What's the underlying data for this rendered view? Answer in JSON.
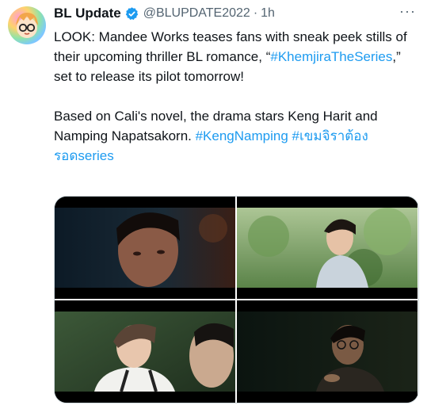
{
  "author": {
    "name": "BL Update",
    "handle": "@BLUPDATE2022",
    "separator": "·",
    "time": "1h",
    "verified": true,
    "avatar_icon": "chibi-glasses-avatar"
  },
  "more_label": "···",
  "tweet": {
    "p1_a": "LOOK: Mandee Works teases fans with sneak peek stills of their upcoming thriller BL romance, “",
    "hashtag1": "#KhemjiraTheSeries",
    "p1_b": ",” set to release its pilot tomorrow!",
    "p2_a": "Based on Cali's novel, the drama stars Keng Harit and Namping Napatsakorn. ",
    "hashtag2": "#KengNamping",
    "hashtag3": "#เขมจิราต้องรอดseries"
  },
  "colors": {
    "text": "#0f1419",
    "secondary": "#536471",
    "link": "#1d9bf0",
    "verified": "#1d9bf0",
    "border": "#cfd9de"
  },
  "media": {
    "count": 4,
    "layout": "2x2 grid"
  }
}
